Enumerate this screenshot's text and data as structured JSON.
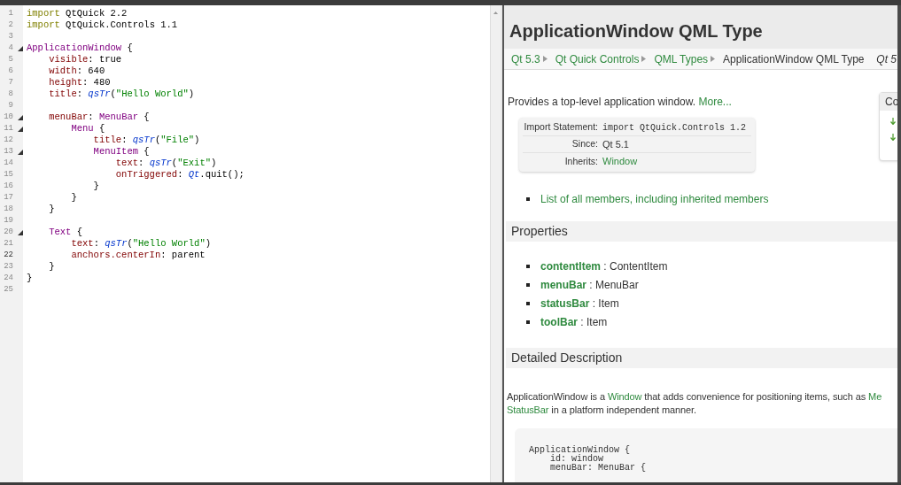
{
  "editor": {
    "lines": [
      {
        "number": "1",
        "fold": false,
        "current": false,
        "tokens": [
          {
            "kind": "keyword",
            "text": "import"
          },
          {
            "kind": "plain",
            "text": " QtQuick 2.2"
          }
        ]
      },
      {
        "number": "2",
        "fold": false,
        "current": false,
        "tokens": [
          {
            "kind": "keyword",
            "text": "import"
          },
          {
            "kind": "plain",
            "text": " QtQuick.Controls 1.1"
          }
        ]
      },
      {
        "number": "3",
        "fold": false,
        "current": false
      },
      {
        "number": "4",
        "fold": true,
        "current": false,
        "tokens": [
          {
            "kind": "type",
            "text": "ApplicationWindow"
          },
          {
            "kind": "plain",
            "text": " {"
          }
        ]
      },
      {
        "number": "5",
        "fold": false,
        "current": false,
        "tokens": [
          {
            "kind": "property",
            "text": "    visible"
          },
          {
            "kind": "plain",
            "text": ": true"
          }
        ]
      },
      {
        "number": "6",
        "fold": false,
        "current": false,
        "tokens": [
          {
            "kind": "property",
            "text": "    width"
          },
          {
            "kind": "plain",
            "text": ": 640"
          }
        ]
      },
      {
        "number": "7",
        "fold": false,
        "current": false,
        "tokens": [
          {
            "kind": "property",
            "text": "    height"
          },
          {
            "kind": "plain",
            "text": ": 480"
          }
        ]
      },
      {
        "number": "8",
        "fold": false,
        "current": false,
        "tokens": [
          {
            "kind": "property",
            "text": "    title"
          },
          {
            "kind": "plain",
            "text": ": "
          },
          {
            "kind": "function",
            "text": "qsTr"
          },
          {
            "kind": "plain",
            "text": "("
          },
          {
            "kind": "string",
            "text": "\"Hello World\""
          },
          {
            "kind": "plain",
            "text": ")"
          }
        ]
      },
      {
        "number": "9",
        "fold": false,
        "current": false
      },
      {
        "number": "10",
        "fold": true,
        "current": false,
        "tokens": [
          {
            "kind": "property",
            "text": "    menuBar"
          },
          {
            "kind": "plain",
            "text": ": "
          },
          {
            "kind": "type",
            "text": "MenuBar"
          },
          {
            "kind": "plain",
            "text": " {"
          }
        ]
      },
      {
        "number": "11",
        "fold": true,
        "current": false,
        "tokens": [
          {
            "kind": "type",
            "text": "        Menu"
          },
          {
            "kind": "plain",
            "text": " {"
          }
        ]
      },
      {
        "number": "12",
        "fold": false,
        "current": false,
        "tokens": [
          {
            "kind": "property",
            "text": "            title"
          },
          {
            "kind": "plain",
            "text": ": "
          },
          {
            "kind": "function",
            "text": "qsTr"
          },
          {
            "kind": "plain",
            "text": "("
          },
          {
            "kind": "string",
            "text": "\"File\""
          },
          {
            "kind": "plain",
            "text": ")"
          }
        ]
      },
      {
        "number": "13",
        "fold": true,
        "current": false,
        "tokens": [
          {
            "kind": "type",
            "text": "            MenuItem"
          },
          {
            "kind": "plain",
            "text": " {"
          }
        ]
      },
      {
        "number": "14",
        "fold": false,
        "current": false,
        "tokens": [
          {
            "kind": "property",
            "text": "                text"
          },
          {
            "kind": "plain",
            "text": ": "
          },
          {
            "kind": "function",
            "text": "qsTr"
          },
          {
            "kind": "plain",
            "text": "("
          },
          {
            "kind": "string",
            "text": "\"Exit\""
          },
          {
            "kind": "plain",
            "text": ")"
          }
        ]
      },
      {
        "number": "15",
        "fold": false,
        "current": false,
        "tokens": [
          {
            "kind": "property",
            "text": "                onTriggered"
          },
          {
            "kind": "plain",
            "text": ": "
          },
          {
            "kind": "function",
            "text": "Qt"
          },
          {
            "kind": "plain",
            "text": ".quit();"
          }
        ]
      },
      {
        "number": "16",
        "fold": false,
        "current": false,
        "tokens": [
          {
            "kind": "plain",
            "text": "            }"
          }
        ]
      },
      {
        "number": "17",
        "fold": false,
        "current": false,
        "tokens": [
          {
            "kind": "plain",
            "text": "        }"
          }
        ]
      },
      {
        "number": "18",
        "fold": false,
        "current": false,
        "tokens": [
          {
            "kind": "plain",
            "text": "    }"
          }
        ]
      },
      {
        "number": "19",
        "fold": false,
        "current": false
      },
      {
        "number": "20",
        "fold": true,
        "current": false,
        "tokens": [
          {
            "kind": "type",
            "text": "    Text"
          },
          {
            "kind": "plain",
            "text": " {"
          }
        ]
      },
      {
        "number": "21",
        "fold": false,
        "current": false,
        "tokens": [
          {
            "kind": "property",
            "text": "        text"
          },
          {
            "kind": "plain",
            "text": ": "
          },
          {
            "kind": "function",
            "text": "qsTr"
          },
          {
            "kind": "plain",
            "text": "("
          },
          {
            "kind": "string",
            "text": "\"Hello World\""
          },
          {
            "kind": "plain",
            "text": ")"
          }
        ]
      },
      {
        "number": "22",
        "fold": false,
        "current": true,
        "tokens": [
          {
            "kind": "property",
            "text": "        anchors.centerIn"
          },
          {
            "kind": "plain",
            "text": ": parent"
          }
        ]
      },
      {
        "number": "23",
        "fold": false,
        "current": false,
        "tokens": [
          {
            "kind": "plain",
            "text": "    }"
          }
        ]
      },
      {
        "number": "24",
        "fold": false,
        "current": false,
        "tokens": [
          {
            "kind": "plain",
            "text": "}"
          }
        ]
      },
      {
        "number": "25",
        "fold": false,
        "current": false
      }
    ]
  },
  "doc": {
    "title": "ApplicationWindow QML Type",
    "breadcrumb": [
      {
        "text": "Qt 5.3",
        "link": true
      },
      {
        "text": "Qt Quick Controls",
        "link": true
      },
      {
        "text": "QML Types",
        "link": true
      },
      {
        "text": "ApplicationWindow QML Type",
        "link": false
      }
    ],
    "version": "Qt 5",
    "intro": {
      "text": "Provides a top-level application window.",
      "link": "More..."
    },
    "info": [
      {
        "label": "Import Statement:",
        "value": "import QtQuick.Controls 1.2",
        "kind": "code"
      },
      {
        "label": "Since:",
        "value": "Qt 5.1",
        "kind": "text"
      },
      {
        "label": "Inherits:",
        "value": "Window",
        "kind": "link"
      }
    ],
    "members_link": "List of all members, including inherited members",
    "toc": {
      "heading": "Co"
    },
    "sections": [
      {
        "title": "Properties"
      },
      {
        "title": "Detailed Description"
      }
    ],
    "properties": [
      {
        "name": "contentItem",
        "type": " : ContentItem"
      },
      {
        "name": "menuBar",
        "type": " : MenuBar"
      },
      {
        "name": "statusBar",
        "type": " : Item"
      },
      {
        "name": "toolBar",
        "type": " : Item"
      }
    ],
    "description": [
      [
        {
          "kind": "text",
          "text": "ApplicationWindow is a "
        },
        {
          "kind": "link",
          "text": "Window"
        },
        {
          "kind": "text",
          "text": " that adds convenience for positioning items, such as "
        },
        {
          "kind": "link",
          "text": "Me"
        }
      ],
      [
        {
          "kind": "link",
          "text": "StatusBar"
        },
        {
          "kind": "text",
          "text": " in a platform independent manner."
        }
      ]
    ],
    "example": [
      "ApplicationWindow {",
      "    id: window",
      "    menuBar: MenuBar {"
    ]
  }
}
